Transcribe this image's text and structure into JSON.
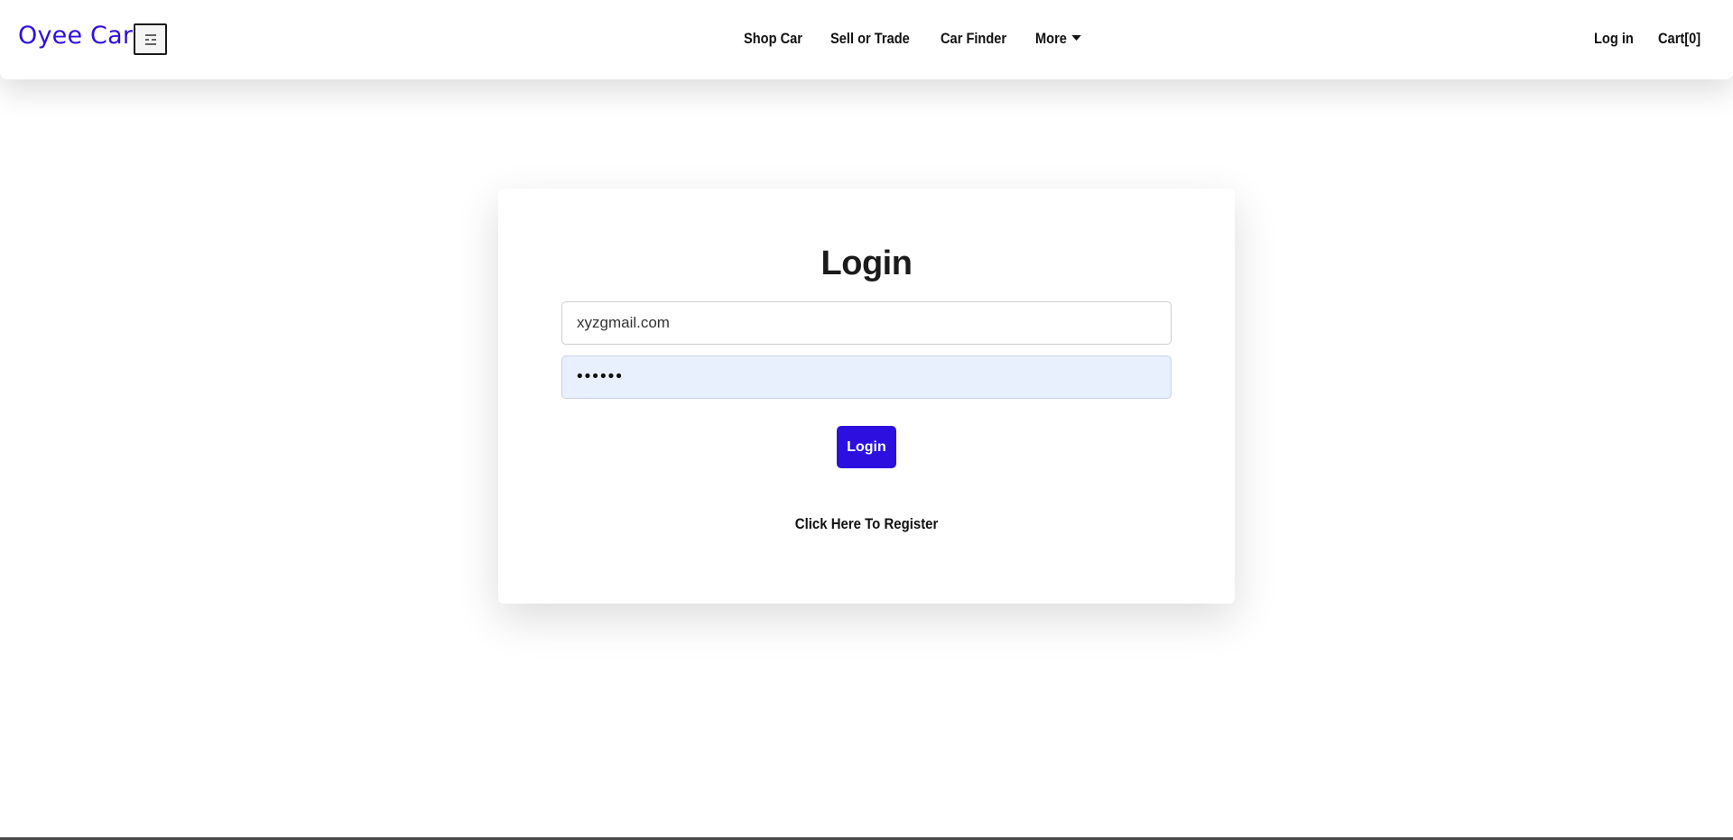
{
  "navbar": {
    "brand": "Oyee Car",
    "toggle_icon": "menu-icon",
    "links": [
      "Shop Car",
      "Sell or Trade",
      "Car Finder"
    ],
    "more_label": "More",
    "login_label": "Log in",
    "cart_label": "Cart[0]"
  },
  "login_card": {
    "title": "Login",
    "email_value": "xyzgmail.com",
    "password_value": "••••••",
    "login_button": "Login",
    "register_link": "Click Here To Register"
  },
  "colors": {
    "accent": "#2d10e0",
    "autofill_bg": "#e8f0fd"
  }
}
